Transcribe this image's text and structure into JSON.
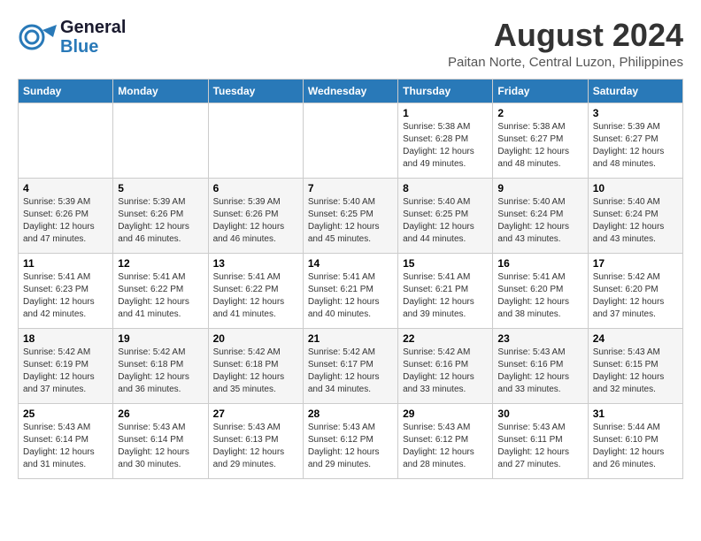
{
  "header": {
    "logo_line1": "General",
    "logo_line2": "Blue",
    "month": "August 2024",
    "location": "Paitan Norte, Central Luzon, Philippines"
  },
  "days_of_week": [
    "Sunday",
    "Monday",
    "Tuesday",
    "Wednesday",
    "Thursday",
    "Friday",
    "Saturday"
  ],
  "weeks": [
    [
      {
        "day": "",
        "info": ""
      },
      {
        "day": "",
        "info": ""
      },
      {
        "day": "",
        "info": ""
      },
      {
        "day": "",
        "info": ""
      },
      {
        "day": "1",
        "info": "Sunrise: 5:38 AM\nSunset: 6:28 PM\nDaylight: 12 hours\nand 49 minutes."
      },
      {
        "day": "2",
        "info": "Sunrise: 5:38 AM\nSunset: 6:27 PM\nDaylight: 12 hours\nand 48 minutes."
      },
      {
        "day": "3",
        "info": "Sunrise: 5:39 AM\nSunset: 6:27 PM\nDaylight: 12 hours\nand 48 minutes."
      }
    ],
    [
      {
        "day": "4",
        "info": "Sunrise: 5:39 AM\nSunset: 6:26 PM\nDaylight: 12 hours\nand 47 minutes."
      },
      {
        "day": "5",
        "info": "Sunrise: 5:39 AM\nSunset: 6:26 PM\nDaylight: 12 hours\nand 46 minutes."
      },
      {
        "day": "6",
        "info": "Sunrise: 5:39 AM\nSunset: 6:26 PM\nDaylight: 12 hours\nand 46 minutes."
      },
      {
        "day": "7",
        "info": "Sunrise: 5:40 AM\nSunset: 6:25 PM\nDaylight: 12 hours\nand 45 minutes."
      },
      {
        "day": "8",
        "info": "Sunrise: 5:40 AM\nSunset: 6:25 PM\nDaylight: 12 hours\nand 44 minutes."
      },
      {
        "day": "9",
        "info": "Sunrise: 5:40 AM\nSunset: 6:24 PM\nDaylight: 12 hours\nand 43 minutes."
      },
      {
        "day": "10",
        "info": "Sunrise: 5:40 AM\nSunset: 6:24 PM\nDaylight: 12 hours\nand 43 minutes."
      }
    ],
    [
      {
        "day": "11",
        "info": "Sunrise: 5:41 AM\nSunset: 6:23 PM\nDaylight: 12 hours\nand 42 minutes."
      },
      {
        "day": "12",
        "info": "Sunrise: 5:41 AM\nSunset: 6:22 PM\nDaylight: 12 hours\nand 41 minutes."
      },
      {
        "day": "13",
        "info": "Sunrise: 5:41 AM\nSunset: 6:22 PM\nDaylight: 12 hours\nand 41 minutes."
      },
      {
        "day": "14",
        "info": "Sunrise: 5:41 AM\nSunset: 6:21 PM\nDaylight: 12 hours\nand 40 minutes."
      },
      {
        "day": "15",
        "info": "Sunrise: 5:41 AM\nSunset: 6:21 PM\nDaylight: 12 hours\nand 39 minutes."
      },
      {
        "day": "16",
        "info": "Sunrise: 5:41 AM\nSunset: 6:20 PM\nDaylight: 12 hours\nand 38 minutes."
      },
      {
        "day": "17",
        "info": "Sunrise: 5:42 AM\nSunset: 6:20 PM\nDaylight: 12 hours\nand 37 minutes."
      }
    ],
    [
      {
        "day": "18",
        "info": "Sunrise: 5:42 AM\nSunset: 6:19 PM\nDaylight: 12 hours\nand 37 minutes."
      },
      {
        "day": "19",
        "info": "Sunrise: 5:42 AM\nSunset: 6:18 PM\nDaylight: 12 hours\nand 36 minutes."
      },
      {
        "day": "20",
        "info": "Sunrise: 5:42 AM\nSunset: 6:18 PM\nDaylight: 12 hours\nand 35 minutes."
      },
      {
        "day": "21",
        "info": "Sunrise: 5:42 AM\nSunset: 6:17 PM\nDaylight: 12 hours\nand 34 minutes."
      },
      {
        "day": "22",
        "info": "Sunrise: 5:42 AM\nSunset: 6:16 PM\nDaylight: 12 hours\nand 33 minutes."
      },
      {
        "day": "23",
        "info": "Sunrise: 5:43 AM\nSunset: 6:16 PM\nDaylight: 12 hours\nand 33 minutes."
      },
      {
        "day": "24",
        "info": "Sunrise: 5:43 AM\nSunset: 6:15 PM\nDaylight: 12 hours\nand 32 minutes."
      }
    ],
    [
      {
        "day": "25",
        "info": "Sunrise: 5:43 AM\nSunset: 6:14 PM\nDaylight: 12 hours\nand 31 minutes."
      },
      {
        "day": "26",
        "info": "Sunrise: 5:43 AM\nSunset: 6:14 PM\nDaylight: 12 hours\nand 30 minutes."
      },
      {
        "day": "27",
        "info": "Sunrise: 5:43 AM\nSunset: 6:13 PM\nDaylight: 12 hours\nand 29 minutes."
      },
      {
        "day": "28",
        "info": "Sunrise: 5:43 AM\nSunset: 6:12 PM\nDaylight: 12 hours\nand 29 minutes."
      },
      {
        "day": "29",
        "info": "Sunrise: 5:43 AM\nSunset: 6:12 PM\nDaylight: 12 hours\nand 28 minutes."
      },
      {
        "day": "30",
        "info": "Sunrise: 5:43 AM\nSunset: 6:11 PM\nDaylight: 12 hours\nand 27 minutes."
      },
      {
        "day": "31",
        "info": "Sunrise: 5:44 AM\nSunset: 6:10 PM\nDaylight: 12 hours\nand 26 minutes."
      }
    ]
  ]
}
